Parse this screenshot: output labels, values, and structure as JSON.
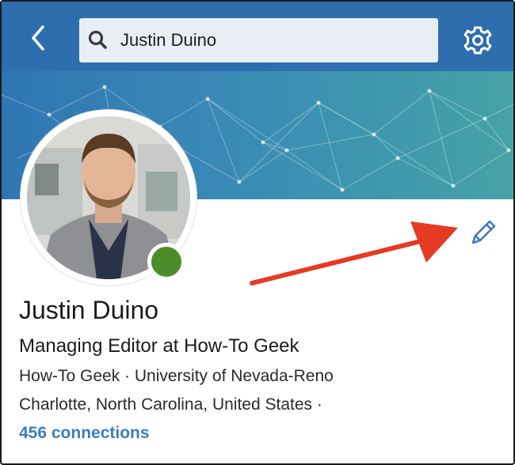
{
  "search": {
    "value": "Justin Duino"
  },
  "icons": {
    "back": "back-chevron-icon",
    "search": "search-icon",
    "settings": "gear-icon",
    "edit": "pencil-icon",
    "annotation": "red-arrow-icon"
  },
  "profile": {
    "name": "Justin Duino",
    "headline": "Managing Editor at How-To Geek",
    "affiliation": "How-To Geek · University of Nevada-Reno",
    "location": "Charlotte, North Carolina, United States ·",
    "connections": "456 connections",
    "online": true
  },
  "colors": {
    "topbar": "#2e6eae",
    "online_status": "#4e8c2b",
    "link": "#3d7dbd",
    "annotation_arrow": "#e53a24"
  }
}
